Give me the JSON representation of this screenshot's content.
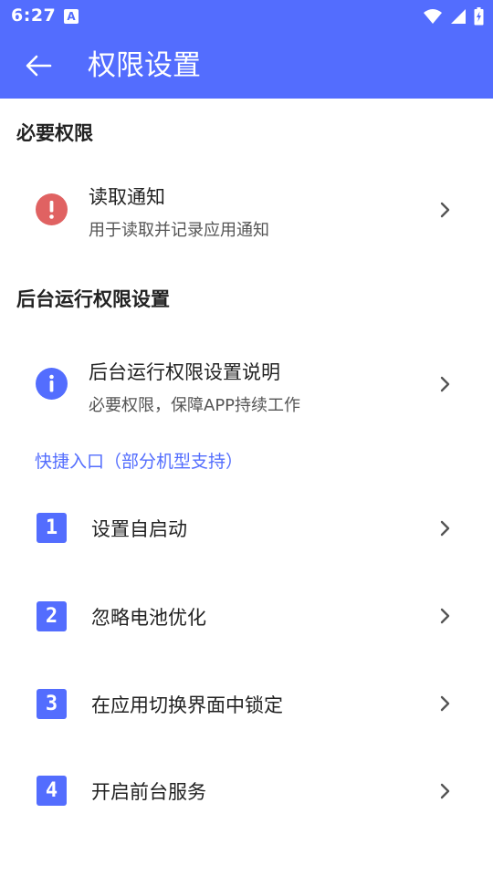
{
  "status_bar": {
    "time": "6:27",
    "notification_icon": "A"
  },
  "app_bar": {
    "title": "权限设置",
    "back_icon": "arrow-back-icon"
  },
  "sections": {
    "required": {
      "header": "必要权限",
      "items": [
        {
          "title": "读取通知",
          "subtitle": "用于读取并记录应用通知",
          "icon": "error-icon",
          "icon_color": "#e06262"
        }
      ]
    },
    "background": {
      "header": "后台运行权限设置",
      "items": [
        {
          "title": "后台运行权限设置说明",
          "subtitle": "必要权限，保障APP持续工作",
          "icon": "info-icon",
          "icon_color": "#536dfe"
        }
      ]
    },
    "shortcuts": {
      "header": "快捷入口（部分机型支持）",
      "items": [
        {
          "number": "1",
          "label": "设置自启动"
        },
        {
          "number": "2",
          "label": "忽略电池优化"
        },
        {
          "number": "3",
          "label": "在应用切换界面中锁定"
        },
        {
          "number": "4",
          "label": "开启前台服务"
        }
      ]
    }
  },
  "colors": {
    "accent": "#536dfe",
    "error": "#e06262"
  }
}
